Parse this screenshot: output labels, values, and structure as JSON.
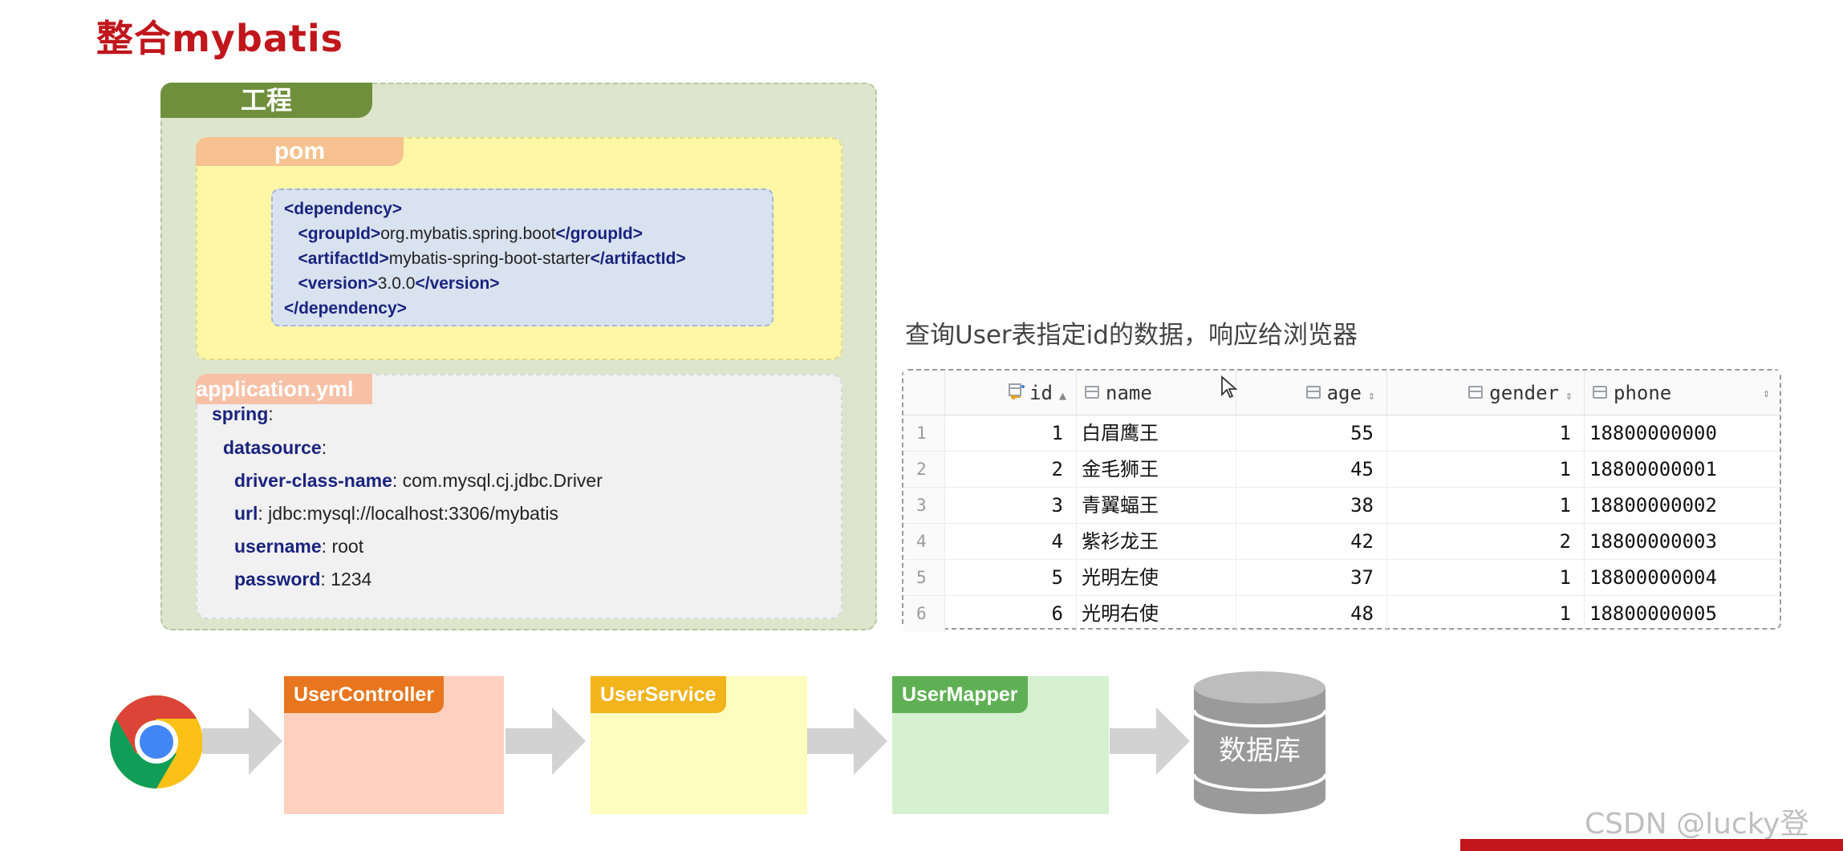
{
  "slide": {
    "title": "整合mybatis"
  },
  "project": {
    "label": "工程",
    "pom": {
      "label": "pom",
      "lines": [
        {
          "open": "<dependency>",
          "text": "",
          "close": ""
        },
        {
          "open": "<groupId>",
          "text": "org.mybatis.spring.boot",
          "close": "</groupId>"
        },
        {
          "open": "<artifactId>",
          "text": "mybatis-spring-boot-starter",
          "close": "</artifactId>"
        },
        {
          "open": "<version>",
          "text": "3.0.0",
          "close": "</version>"
        },
        {
          "open": "</dependency>",
          "text": "",
          "close": ""
        }
      ]
    },
    "yml": {
      "label": "application.yml",
      "lines": [
        {
          "key": "spring",
          "value": ":"
        },
        {
          "key": "datasource",
          "value": ":"
        },
        {
          "key": "driver-class-name",
          "value": ": com.mysql.cj.jdbc.Driver"
        },
        {
          "key": "url",
          "value": ": jdbc:mysql://localhost:3306/mybatis"
        },
        {
          "key": "username",
          "value": ": root"
        },
        {
          "key": "password",
          "value": ": 1234"
        }
      ]
    }
  },
  "table": {
    "caption": "查询User表指定id的数据，响应给浏览器",
    "columns": [
      "id",
      "name",
      "age",
      "gender",
      "phone"
    ],
    "rows": [
      {
        "n": "1",
        "id": "1",
        "name": "白眉鹰王",
        "age": "55",
        "gender": "1",
        "phone": "18800000000"
      },
      {
        "n": "2",
        "id": "2",
        "name": "金毛狮王",
        "age": "45",
        "gender": "1",
        "phone": "18800000001"
      },
      {
        "n": "3",
        "id": "3",
        "name": "青翼蝠王",
        "age": "38",
        "gender": "1",
        "phone": "18800000002"
      },
      {
        "n": "4",
        "id": "4",
        "name": "紫衫龙王",
        "age": "42",
        "gender": "2",
        "phone": "18800000003"
      },
      {
        "n": "5",
        "id": "5",
        "name": "光明左使",
        "age": "37",
        "gender": "1",
        "phone": "18800000004"
      },
      {
        "n": "6",
        "id": "6",
        "name": "光明右使",
        "age": "48",
        "gender": "1",
        "phone": "18800000005"
      }
    ]
  },
  "flow": {
    "controller": "UserController",
    "service": "UserService",
    "mapper": "UserMapper",
    "database": "数据库"
  },
  "watermark": "CSDN @lucky登",
  "icons": {
    "browser": "chrome-icon",
    "database": "database-icon"
  },
  "colors": {
    "title": "#c0161c",
    "project_tab": "#6f8f3c",
    "controller_tab": "#e8761e",
    "service_tab": "#f2b31b",
    "mapper_tab": "#5fb054"
  }
}
